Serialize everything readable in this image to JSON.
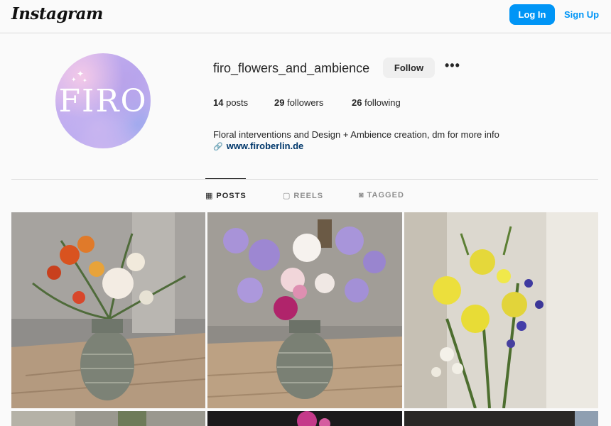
{
  "header": {
    "logo_text": "Instagram",
    "login_label": "Log In",
    "signup_label": "Sign Up",
    "accent_color": "#0095f6"
  },
  "profile": {
    "avatar_text": "FIRO",
    "username": "firo_flowers_and_ambience",
    "follow_label": "Follow",
    "more_label": "•••",
    "stats": {
      "posts_count": "14",
      "posts_label": "posts",
      "followers_count": "29",
      "followers_label": "followers",
      "following_count": "26",
      "following_label": "following"
    },
    "bio": "Floral interventions and Design + Ambience creation, dm for more info",
    "website": "www.firoberlin.de",
    "link_icon": "link-icon"
  },
  "tabs": [
    {
      "label": "POSTS",
      "icon": "grid-icon",
      "active": true
    },
    {
      "label": "REELS",
      "icon": "reels-icon",
      "active": false
    },
    {
      "label": "TAGGED",
      "icon": "tagged-icon",
      "active": false
    }
  ],
  "posts": [
    {
      "subject": "orange-white-dahlia-bouquet-in-vase"
    },
    {
      "subject": "purple-aster-white-dahlia-bouquet-in-vase"
    },
    {
      "subject": "yellow-lily-blue-delphinium-bouquet"
    },
    {
      "subject": "post-4"
    },
    {
      "subject": "post-5"
    },
    {
      "subject": "post-6"
    }
  ]
}
